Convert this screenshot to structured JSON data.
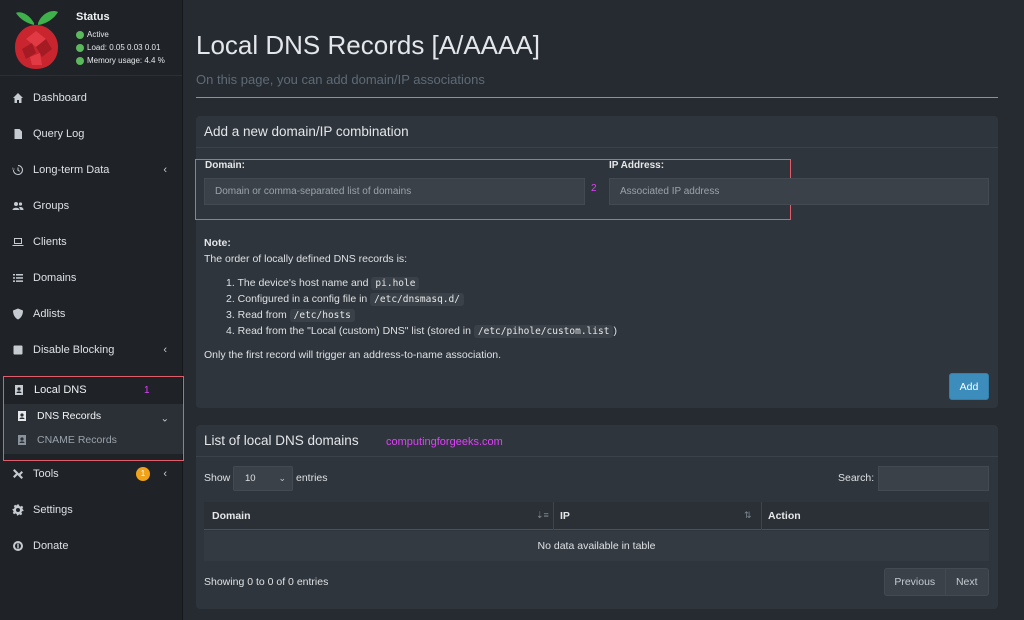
{
  "status": {
    "title": "Status",
    "active": "Active",
    "load": "Load:  0.05  0.03  0.01",
    "memory": "Memory usage:  4.4 %"
  },
  "nav": {
    "dashboard": "Dashboard",
    "query_log": "Query Log",
    "long_term": "Long-term Data",
    "groups": "Groups",
    "clients": "Clients",
    "domains": "Domains",
    "adlists": "Adlists",
    "disable_blocking": "Disable Blocking",
    "local_dns": "Local DNS",
    "dns_records": "DNS Records",
    "cname_records": "CNAME Records",
    "tools": "Tools",
    "tools_badge": "1",
    "settings": "Settings",
    "donate": "Donate"
  },
  "annotations": {
    "one": "1",
    "two": "2"
  },
  "page": {
    "title": "Local DNS Records [A/AAAA]",
    "subtitle": "On this page, you can add domain/IP associations"
  },
  "add_box": {
    "title": "Add a new domain/IP combination",
    "domain_label": "Domain:",
    "domain_placeholder": "Domain or comma-separated list of domains",
    "ip_label": "IP Address:",
    "ip_placeholder": "Associated IP address",
    "note_heading": "Note:",
    "note_intro": "The order of locally defined DNS records is:",
    "items": [
      {
        "text": "1. The device's host name and ",
        "code": "pi.hole",
        "tail": ""
      },
      {
        "text": "2. Configured in a config file in ",
        "code": "/etc/dnsmasq.d/",
        "tail": ""
      },
      {
        "text": "3. Read from ",
        "code": "/etc/hosts",
        "tail": ""
      },
      {
        "text": "4. Read from the \"Local (custom) DNS\" list (stored in ",
        "code": "/etc/pihole/custom.list",
        "tail": ")"
      }
    ],
    "note_footer": "Only the first record will trigger an address-to-name association.",
    "add_button": "Add"
  },
  "list_box": {
    "title": "List of local DNS domains",
    "watermark": "computingforgeeks.com",
    "show_label": "Show",
    "entries_label": "entries",
    "page_size": "10",
    "search_label": "Search:",
    "columns": [
      "Domain",
      "IP",
      "Action"
    ],
    "empty_text": "No data available in table",
    "info": "Showing 0 to 0 of 0 entries",
    "prev": "Previous",
    "next": "Next"
  },
  "colors": {
    "sidebar": "#1f2328",
    "main_bg": "#262b31",
    "box_bg": "#2f353c",
    "accent": "#3c8dbc",
    "highlight": "#e05d6c",
    "annotation": "#e040fb",
    "badge": "#f0a21a",
    "status_green": "#5cb85c"
  }
}
